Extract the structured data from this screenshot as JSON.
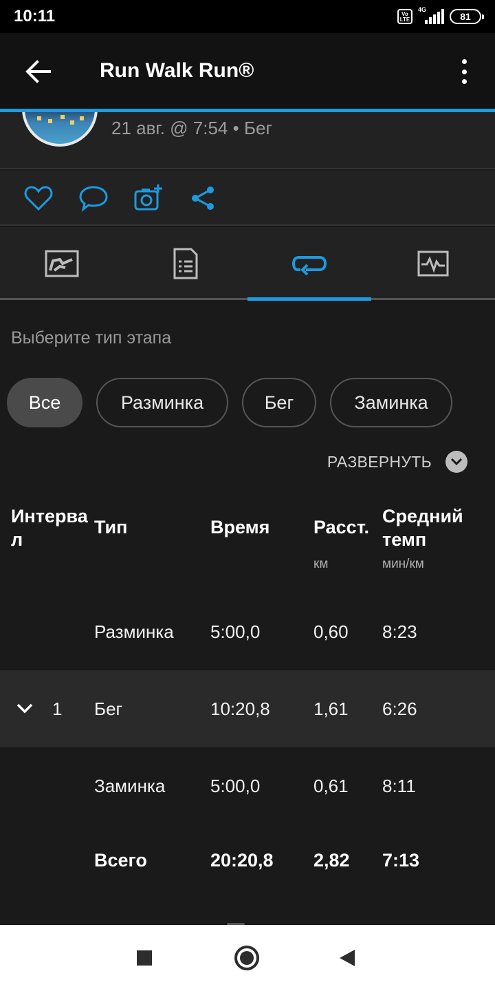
{
  "status_bar": {
    "time": "10:11",
    "volte_label": "Vo LTE",
    "network": "4G",
    "battery": "81"
  },
  "app_bar": {
    "title": "Run Walk Run®",
    "back_icon": "arrow-left-icon",
    "menu_icon": "more-vertical-icon"
  },
  "activity": {
    "meta": "21 авг. @ 7:54 • Бег"
  },
  "social": {
    "icons": [
      "heart-icon",
      "comment-icon",
      "add-photo-icon",
      "share-icon"
    ]
  },
  "tabs": {
    "icons": [
      "map-icon",
      "details-icon",
      "laps-icon",
      "chart-icon"
    ],
    "active_index": 2
  },
  "filter": {
    "prompt": "Выберите тип этапа",
    "chips": [
      "Все",
      "Разминка",
      "Бег",
      "Заминка"
    ],
    "active_chip": "Все"
  },
  "expand": {
    "label": "РАЗВЕРНУТЬ"
  },
  "table": {
    "headers": {
      "interval_line1": "Интерва",
      "interval_line2": "л",
      "type": "Тип",
      "time": "Время",
      "distance": "Расст.",
      "distance_unit": "км",
      "pace_line1": "Средний",
      "pace_line2": "темп",
      "pace_unit": "мин/км"
    },
    "rows": [
      {
        "interval": "",
        "type": "Разминка",
        "time": "5:00,0",
        "distance": "0,60",
        "pace": "8:23"
      },
      {
        "interval": "1",
        "type": "Бег",
        "time": "10:20,8",
        "distance": "1,61",
        "pace": "6:26"
      },
      {
        "interval": "",
        "type": "Заминка",
        "time": "5:00,0",
        "distance": "0,61",
        "pace": "8:11"
      }
    ],
    "total": {
      "type": "Всего",
      "time": "20:20,8",
      "distance": "2,82",
      "pace": "7:13"
    }
  },
  "colors": {
    "accent": "#1b9be0",
    "background": "#1a1a1a",
    "panel": "#222222"
  }
}
